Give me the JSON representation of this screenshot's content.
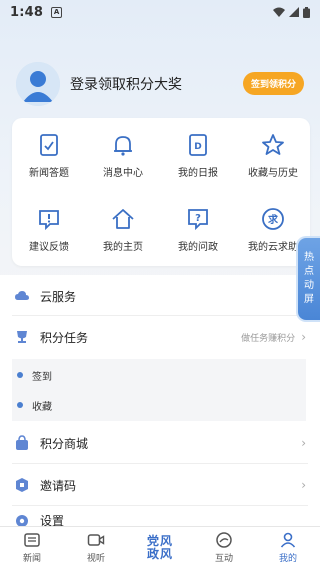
{
  "status": {
    "time": "1:48",
    "notif_glyph": "A"
  },
  "profile": {
    "name": "登录领取积分大奖",
    "points_button": "签到领积分"
  },
  "grid": {
    "items": [
      {
        "label": "新闻答题",
        "icon": "quiz-icon"
      },
      {
        "label": "消息中心",
        "icon": "bell-icon"
      },
      {
        "label": "我的日报",
        "icon": "daily-report-icon"
      },
      {
        "label": "收藏与历史",
        "icon": "star-icon"
      },
      {
        "label": "建议反馈",
        "icon": "feedback-icon"
      },
      {
        "label": "我的主页",
        "icon": "home-icon"
      },
      {
        "label": "我的问政",
        "icon": "question-icon"
      },
      {
        "label": "我的云求助",
        "icon": "help-request-icon"
      }
    ]
  },
  "side_tab": {
    "chars": [
      "热",
      "点",
      "动",
      "屏"
    ]
  },
  "list": {
    "cloud_service": "云服务",
    "points_task": "积分任务",
    "points_task_hint": "做任务赚积分",
    "sub_items": [
      "签到",
      "收藏"
    ],
    "points_mall": "积分商城",
    "invite_code": "邀请码",
    "settings": "设置"
  },
  "tabbar": {
    "tabs": [
      {
        "label": "新闻",
        "icon": "news-icon"
      },
      {
        "label": "视听",
        "icon": "video-icon"
      },
      {
        "label": "党风政风",
        "icon": "center-logo"
      },
      {
        "label": "互动",
        "icon": "interact-icon"
      },
      {
        "label": "我的",
        "icon": "profile-icon"
      }
    ],
    "center_line1": "党风",
    "center_line2": "政风",
    "active_color": "#3b6fc8"
  },
  "colors": {
    "accent": "#3b6fc8",
    "points_button": "#f6a623"
  }
}
